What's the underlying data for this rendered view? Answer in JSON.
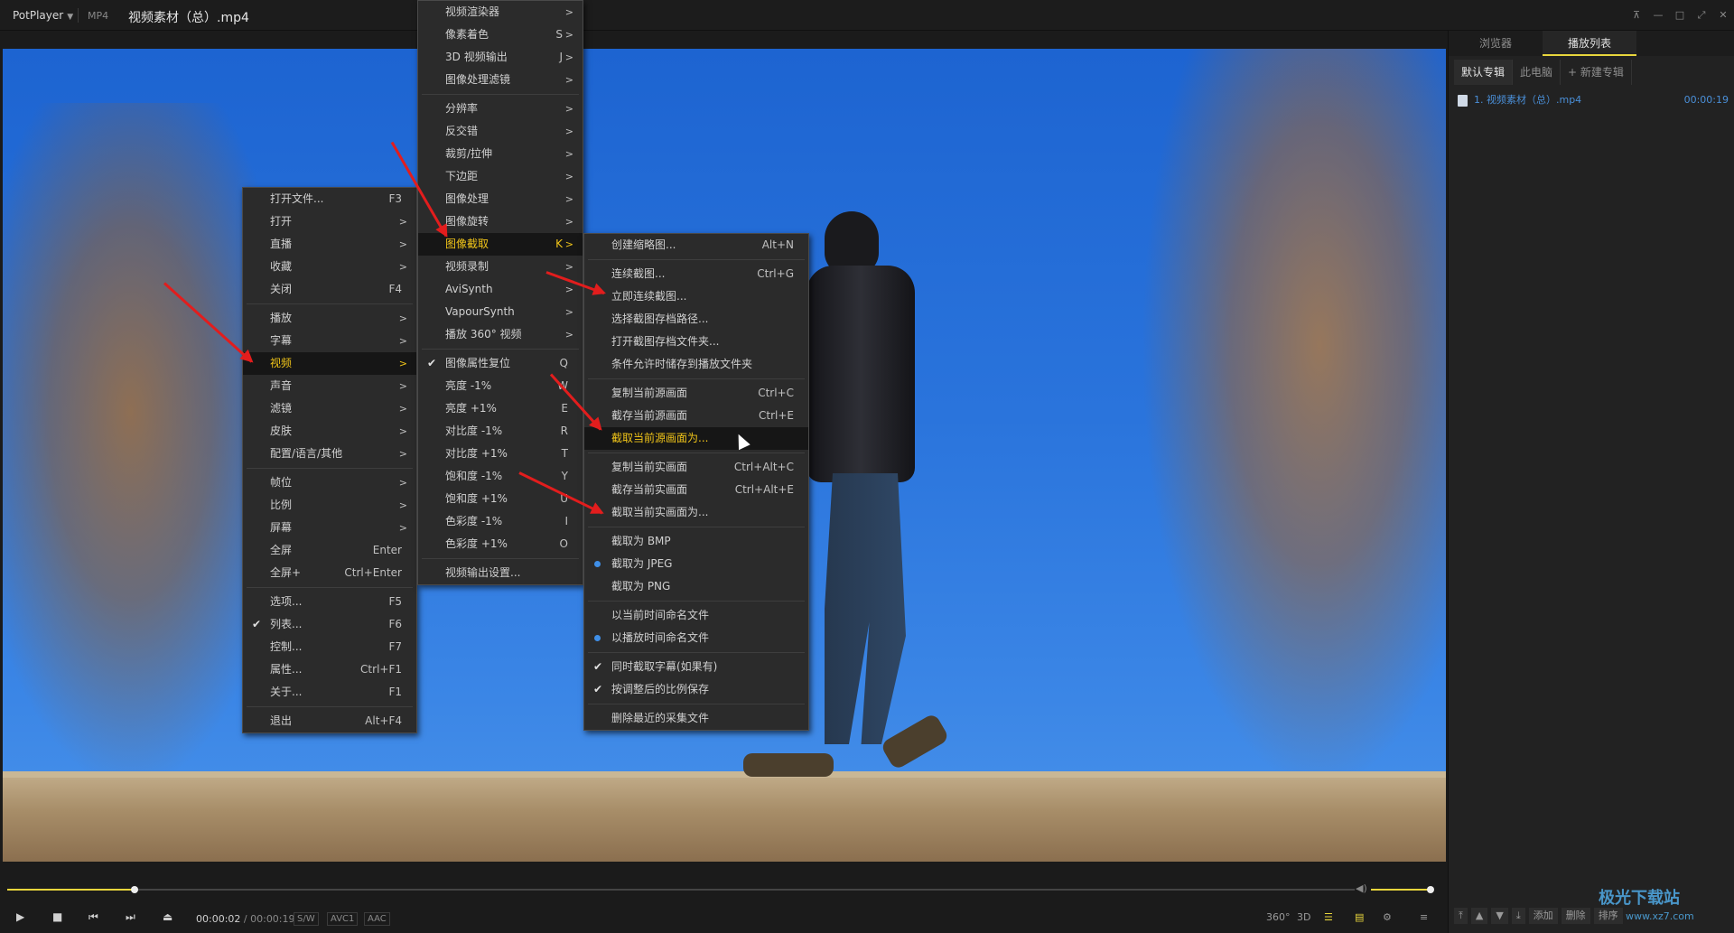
{
  "titlebar": {
    "app": "PotPlayer",
    "format": "MP4",
    "title": "视频素材（总）.mp4"
  },
  "panel": {
    "tabs": [
      "浏览器",
      "播放列表"
    ],
    "albums": [
      "默认专辑",
      "此电脑",
      "+ 新建专辑"
    ],
    "items": [
      {
        "name": "1. 视频素材（总）.mp4",
        "duration": "00:00:19"
      }
    ],
    "bottom_buttons": [
      "添加",
      "删除",
      "排序"
    ]
  },
  "controls": {
    "time_current": "00:00:02",
    "time_sep": " / ",
    "time_total": "00:00:19",
    "tags": [
      "S/W",
      "AVC1",
      "AAC"
    ],
    "right": [
      "360°",
      "3D"
    ],
    "progress_fraction": 0.0947
  },
  "main_menu": [
    {
      "label": "打开文件...",
      "shortcut": "F3"
    },
    {
      "label": "打开",
      "submenu": true
    },
    {
      "label": "直播",
      "submenu": true
    },
    {
      "label": "收藏",
      "submenu": true
    },
    {
      "label": "关闭",
      "shortcut": "F4"
    },
    {
      "sep": true
    },
    {
      "label": "播放",
      "submenu": true
    },
    {
      "label": "字幕",
      "submenu": true
    },
    {
      "label": "视频",
      "submenu": true,
      "highlight": true
    },
    {
      "label": "声音",
      "submenu": true
    },
    {
      "label": "滤镜",
      "submenu": true
    },
    {
      "label": "皮肤",
      "submenu": true
    },
    {
      "label": "配置/语言/其他",
      "submenu": true
    },
    {
      "sep": true
    },
    {
      "label": "帧位",
      "submenu": true
    },
    {
      "label": "比例",
      "submenu": true
    },
    {
      "label": "屏幕",
      "submenu": true
    },
    {
      "label": "全屏",
      "shortcut": "Enter"
    },
    {
      "label": "全屏+",
      "shortcut": "Ctrl+Enter"
    },
    {
      "sep": true
    },
    {
      "label": "选项...",
      "shortcut": "F5"
    },
    {
      "label": "列表...",
      "shortcut": "F6",
      "check": true
    },
    {
      "label": "控制...",
      "shortcut": "F7"
    },
    {
      "label": "属性...",
      "shortcut": "Ctrl+F1"
    },
    {
      "label": "关于...",
      "shortcut": "F1"
    },
    {
      "sep": true
    },
    {
      "label": "退出",
      "shortcut": "Alt+F4"
    }
  ],
  "video_menu": [
    {
      "label": "视频渲染器",
      "submenu": true
    },
    {
      "label": "像素着色",
      "shortcut": "S",
      "submenu": true
    },
    {
      "label": "3D 视频输出",
      "shortcut": "J",
      "submenu": true
    },
    {
      "label": "图像处理滤镜",
      "submenu": true
    },
    {
      "sep": true
    },
    {
      "label": "分辨率",
      "submenu": true
    },
    {
      "label": "反交错",
      "submenu": true
    },
    {
      "label": "裁剪/拉伸",
      "submenu": true
    },
    {
      "label": "下边距",
      "submenu": true
    },
    {
      "label": "图像处理",
      "submenu": true
    },
    {
      "label": "图像旋转",
      "submenu": true
    },
    {
      "label": "图像截取",
      "shortcut": "K",
      "submenu": true,
      "highlight": true
    },
    {
      "label": "视频录制",
      "submenu": true
    },
    {
      "label": "AviSynth",
      "submenu": true
    },
    {
      "label": "VapourSynth",
      "submenu": true
    },
    {
      "label": "播放 360° 视频",
      "submenu": true
    },
    {
      "sep": true
    },
    {
      "label": "图像属性复位",
      "shortcut": "Q",
      "check": true
    },
    {
      "label": "亮度 -1%",
      "shortcut": "W"
    },
    {
      "label": "亮度 +1%",
      "shortcut": "E"
    },
    {
      "label": "对比度 -1%",
      "shortcut": "R"
    },
    {
      "label": "对比度 +1%",
      "shortcut": "T"
    },
    {
      "label": "饱和度 -1%",
      "shortcut": "Y"
    },
    {
      "label": "饱和度 +1%",
      "shortcut": "U"
    },
    {
      "label": "色彩度 -1%",
      "shortcut": "I"
    },
    {
      "label": "色彩度 +1%",
      "shortcut": "O"
    },
    {
      "sep": true
    },
    {
      "label": "视频输出设置..."
    }
  ],
  "capture_menu": [
    {
      "label": "创建缩略图...",
      "shortcut": "Alt+N"
    },
    {
      "sep": true
    },
    {
      "label": "连续截图...",
      "shortcut": "Ctrl+G"
    },
    {
      "label": "立即连续截图..."
    },
    {
      "label": "选择截图存档路径..."
    },
    {
      "label": "打开截图存档文件夹..."
    },
    {
      "label": "条件允许时储存到播放文件夹"
    },
    {
      "sep": true
    },
    {
      "label": "复制当前源画面",
      "shortcut": "Ctrl+C"
    },
    {
      "label": "截存当前源画面",
      "shortcut": "Ctrl+E"
    },
    {
      "label": "截取当前源画面为...",
      "highlight": true
    },
    {
      "sep": true
    },
    {
      "label": "复制当前实画面",
      "shortcut": "Ctrl+Alt+C"
    },
    {
      "label": "截存当前实画面",
      "shortcut": "Ctrl+Alt+E"
    },
    {
      "label": "截取当前实画面为..."
    },
    {
      "sep": true
    },
    {
      "label": "截取为 BMP"
    },
    {
      "label": "截取为 JPEG",
      "radio": true
    },
    {
      "label": "截取为 PNG"
    },
    {
      "sep": true
    },
    {
      "label": "以当前时间命名文件"
    },
    {
      "label": "以播放时间命名文件",
      "radio": true
    },
    {
      "sep": true
    },
    {
      "label": "同时截取字幕(如果有)",
      "check": true
    },
    {
      "label": "按调整后的比例保存",
      "check": true
    },
    {
      "sep": true
    },
    {
      "label": "删除最近的采集文件"
    }
  ],
  "watermark": {
    "title": "极光下载站",
    "url": "www.xz7.com"
  },
  "colors": {
    "accent": "#e8d63c",
    "highlight_text": "#f0c419",
    "arrow": "#e21d1d",
    "playlist": "#4a8fd8"
  }
}
